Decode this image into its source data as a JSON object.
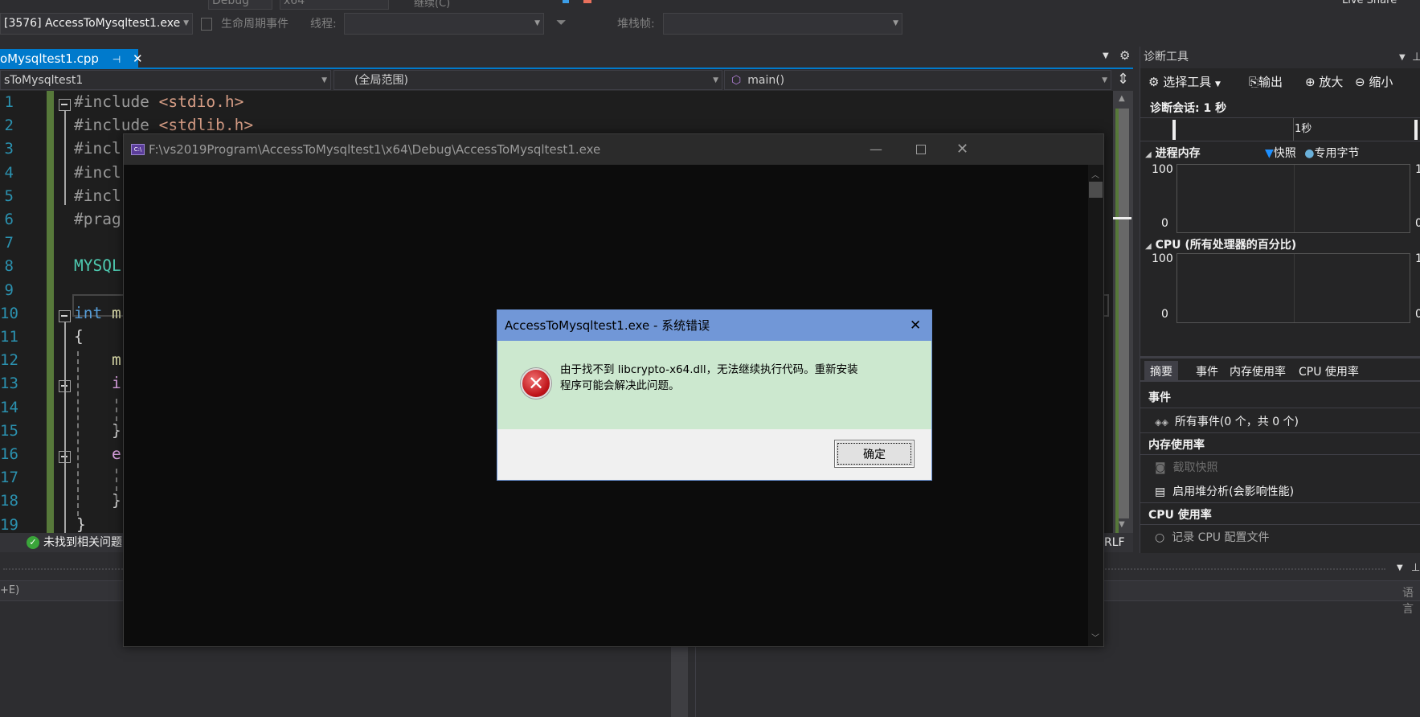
{
  "toolbar": {
    "config": "Debug",
    "platform": "x64",
    "continue_label": "继续(C)",
    "live_share": "Live Share"
  },
  "debug_bar": {
    "process": "[3576] AccessToMysqltest1.exe",
    "lifecycle": "生命周期事件",
    "thread_label": "线程:",
    "stack_label": "堆栈帧:"
  },
  "editor": {
    "tab_label": "oMysqltest1.cpp",
    "nav_project": "sToMysqltest1",
    "nav_scope": "(全局范围)",
    "nav_function": "main()",
    "lines": [
      {
        "n": "1",
        "parts": [
          [
            "#include ",
            "pp"
          ],
          [
            "<stdio.h>",
            "str"
          ]
        ]
      },
      {
        "n": "2",
        "parts": [
          [
            "#include ",
            "pp"
          ],
          [
            "<stdlib.h>",
            "str"
          ]
        ]
      },
      {
        "n": "3",
        "parts": [
          [
            "#incl",
            "pp"
          ]
        ]
      },
      {
        "n": "4",
        "parts": [
          [
            "#incl",
            "pp"
          ]
        ]
      },
      {
        "n": "5",
        "parts": [
          [
            "#incl",
            "pp"
          ]
        ]
      },
      {
        "n": "6",
        "parts": [
          [
            "#prag",
            "pp"
          ]
        ]
      },
      {
        "n": "7",
        "parts": []
      },
      {
        "n": "8",
        "parts": [
          [
            "MYSQL",
            "type"
          ]
        ]
      },
      {
        "n": "9",
        "parts": []
      },
      {
        "n": "10",
        "parts": [
          [
            "int ",
            "kw"
          ],
          [
            "m",
            "fn"
          ]
        ]
      },
      {
        "n": "11",
        "parts": [
          [
            "{",
            "brace"
          ]
        ]
      },
      {
        "n": "12",
        "parts": [
          [
            "    m",
            "fn"
          ]
        ]
      },
      {
        "n": "13",
        "parts": [
          [
            "    i",
            "ctl"
          ]
        ]
      },
      {
        "n": "14",
        "parts": []
      },
      {
        "n": "15",
        "parts": [
          [
            "    }",
            "brace"
          ]
        ]
      },
      {
        "n": "16",
        "parts": [
          [
            "    e",
            "ctl"
          ]
        ]
      },
      {
        "n": "17",
        "parts": []
      },
      {
        "n": "18",
        "parts": [
          [
            "    }",
            "brace"
          ]
        ]
      },
      {
        "n": "19",
        "parts": [
          [
            "}",
            "brace"
          ]
        ]
      }
    ],
    "status_issues": "未找到相关问题",
    "line_ending": "RLF"
  },
  "bottom_panel": {
    "search_hint": "+E)",
    "language_col": "语言"
  },
  "console": {
    "title": "F:\\vs2019Program\\AccessToMysqltest1\\x64\\Debug\\AccessToMysqltest1.exe"
  },
  "dialog": {
    "title": "AccessToMysqltest1.exe - 系统错误",
    "message": "由于找不到 libcrypto-x64.dll，无法继续执行代码。重新安装程序可能会解决此问题。",
    "ok_label": "确定"
  },
  "diag": {
    "title": "诊断工具",
    "select_tools": "选择工具",
    "output": "输出",
    "zoom_in": "放大",
    "zoom_out": "缩小",
    "session": "诊断会话: 1 秒",
    "timeline_tick": "1秒",
    "mem_title": "进程内存",
    "legend_snapshot": "快照",
    "legend_private": "专用字节",
    "mem_ymax": "100",
    "mem_ymin": "0",
    "cpu_title": "CPU (所有处理器的百分比)",
    "cpu_ymax": "100",
    "cpu_ymin": "0",
    "right_ymax": "1",
    "right_ymin": "0",
    "tabs": [
      "摘要",
      "事件",
      "内存使用率",
      "CPU 使用率"
    ],
    "events_header": "事件",
    "all_events": "所有事件(0 个，共 0 个)",
    "mem_header": "内存使用率",
    "take_snapshot": "截取快照",
    "heap_profiling": "启用堆分析(会影响性能)",
    "cpu_header": "CPU 使用率",
    "cpu_record": "记录 CPU 配置文件"
  },
  "colors": {
    "accent": "#007acc",
    "dialog_title": "#7197d7",
    "dialog_body": "#cce8cf",
    "error_red": "#d32f2f"
  }
}
